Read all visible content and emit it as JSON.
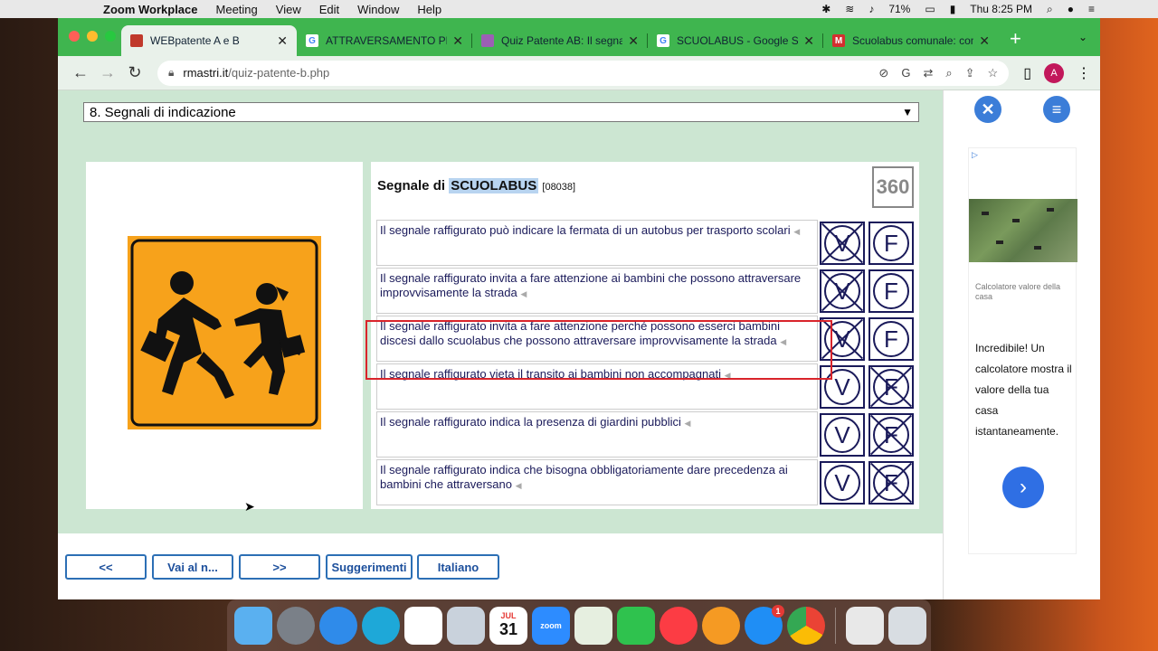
{
  "menubar": {
    "app": "Zoom Workplace",
    "items": [
      "Meeting",
      "View",
      "Edit",
      "Window",
      "Help"
    ],
    "battery": "71%",
    "clock": "Thu 8:25 PM"
  },
  "browser": {
    "tabs": [
      {
        "label": "WEBpatente A e B",
        "color": "#c0392b",
        "letter": ""
      },
      {
        "label": "ATTRAVERSAMENTO PEDO",
        "color": "#4285f4",
        "letter": "G"
      },
      {
        "label": "Quiz Patente AB: Il segnale",
        "color": "#9c5fb5",
        "letter": ""
      },
      {
        "label": "SCUOLABUS - Google Sea",
        "color": "#4285f4",
        "letter": "G"
      },
      {
        "label": "Scuolabus comunale: com",
        "color": "#d32f2f",
        "letter": "M"
      }
    ],
    "url_domain": "rmastri.it",
    "url_path": "/quiz-patente-b.php",
    "avatar": "A"
  },
  "quiz": {
    "category": "8. Segnali di indicazione",
    "title_prefix": "Segnale di",
    "title_highlight": "SCUOLABUS",
    "title_code": "[08038]",
    "number": "360",
    "answers": [
      {
        "text": "Il segnale raffigurato può indicare la fermata di un autobus per trasporto scolari",
        "correct": "V"
      },
      {
        "text": "Il segnale raffigurato invita a fare attenzione ai bambini che possono attraversare improvvisamente la strada",
        "correct": "V"
      },
      {
        "text": "Il segnale raffigurato invita a fare attenzione perché possono esserci bambini discesi dallo scuolabus che possono attraversare improvvisamente la strada",
        "correct": "V"
      },
      {
        "text": "Il segnale raffigurato vieta il transito ai bambini non accompagnati",
        "correct": "F"
      },
      {
        "text": "Il segnale raffigurato indica la presenza di giardini pubblici",
        "correct": "F"
      },
      {
        "text": "Il segnale raffigurato indica che bisogna obbligatoriamente dare precedenza ai bambini che attraversano",
        "correct": "F"
      }
    ],
    "buttons": {
      "prev": "<<",
      "goto": "Vai al n...",
      "next": ">>",
      "hints": "Suggerimenti",
      "lang": "Italiano"
    }
  },
  "ad": {
    "caption": "Calcolatore valore della casa",
    "body": "Incredibile! Un calcolatore mostra il valore della tua casa istantaneamente."
  },
  "dock": {
    "calendar_month": "JUL",
    "calendar_day": "31",
    "zoom_label": "zoom",
    "appstore_badge": "1"
  },
  "colors": {
    "page_bg": "#cce6d2",
    "tab_bar": "#3fb54f",
    "sign_orange": "#f7a21b",
    "answer_ink": "#1a1a5a",
    "highlight_box": "#d9242b"
  }
}
